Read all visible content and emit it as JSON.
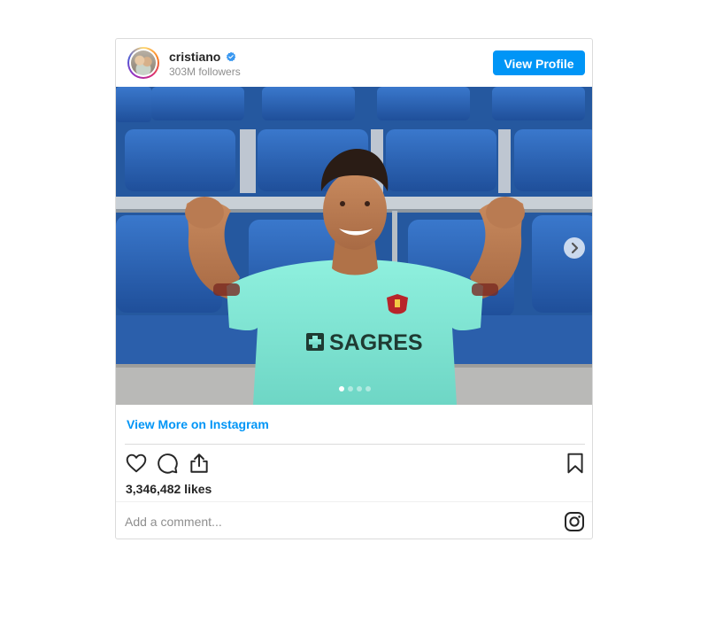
{
  "header": {
    "username": "cristiano",
    "followers": "303M followers",
    "view_profile_label": "View Profile"
  },
  "post": {
    "jersey_text": "SAGRES",
    "carousel_total": 4,
    "carousel_active": 1
  },
  "links": {
    "view_more_label": "View More on Instagram"
  },
  "actions": {
    "likes": "3,346,482 likes"
  },
  "comment": {
    "placeholder": "Add a comment..."
  },
  "colors": {
    "accent": "#0095f6",
    "border": "#dbdbdb",
    "muted": "#8e8e8e",
    "jersey": "#7fe0cf",
    "seats": "#2d63b6"
  },
  "icons": [
    "verified-badge-icon",
    "chevron-right-icon",
    "heart-icon",
    "comment-icon",
    "share-icon",
    "bookmark-icon",
    "instagram-icon"
  ]
}
